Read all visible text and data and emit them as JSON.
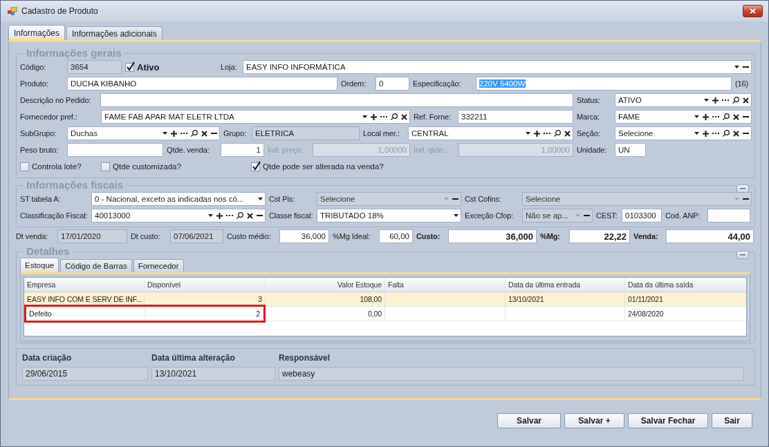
{
  "window": {
    "title": "Cadastro de Produto"
  },
  "tabs": [
    {
      "label": "Informações",
      "selected": true
    },
    {
      "label": "Informações adicionais",
      "selected": false
    }
  ],
  "general": {
    "title": "Informações gerais",
    "lines": [
      {
        "fields": [
          {
            "kind": "label",
            "text": "Código:"
          },
          {
            "kind": "readonly",
            "value": "3654"
          },
          {
            "kind": "check",
            "label": "Ativo",
            "checked": true,
            "bold": true
          },
          {
            "kind": "label",
            "text": "Loja:"
          },
          {
            "kind": "combo",
            "value": "EASY INFO INFORMÁTICA",
            "tools": [
              {
                "kind": "dropdown"
              },
              {
                "kind": "remove"
              }
            ]
          }
        ]
      },
      {
        "fields": [
          {
            "kind": "label",
            "text": "Produto:"
          },
          {
            "kind": "input",
            "value": "DUCHA KIBANHO"
          },
          {
            "kind": "label",
            "text": "Ordem:"
          },
          {
            "kind": "input",
            "value": "0"
          },
          {
            "kind": "label",
            "text": "Especificação:"
          },
          {
            "kind": "input",
            "value": "220V 5400W",
            "text_selected": true
          },
          {
            "kind": "label",
            "text": "(16)"
          }
        ]
      },
      {
        "fields": [
          {
            "kind": "label",
            "text": "Descrição no Pedido:"
          },
          {
            "kind": "input"
          },
          {
            "kind": "label",
            "text": "Status:"
          },
          {
            "kind": "combo",
            "value": "ATIVO",
            "tools": [
              {
                "kind": "dropdown"
              },
              {
                "kind": "add"
              },
              {
                "kind": "more"
              },
              {
                "kind": "search"
              },
              {
                "kind": "clear"
              }
            ]
          }
        ]
      },
      {
        "fields": [
          {
            "kind": "label",
            "text": "Fornecedor pref.:"
          },
          {
            "kind": "combo",
            "value": "FAME FAB APAR MAT ELETR LTDA",
            "tools": [
              {
                "kind": "dropdown"
              },
              {
                "kind": "add"
              },
              {
                "kind": "more"
              },
              {
                "kind": "search"
              },
              {
                "kind": "clear"
              }
            ]
          },
          {
            "kind": "label",
            "text": "Ref. Forne:"
          },
          {
            "kind": "input",
            "value": "332211"
          },
          {
            "kind": "label",
            "text": "Marca:"
          },
          {
            "kind": "combo",
            "value": "FAME",
            "tools": [
              {
                "kind": "dropdown"
              },
              {
                "kind": "add"
              },
              {
                "kind": "more"
              },
              {
                "kind": "search"
              },
              {
                "kind": "clear"
              },
              {
                "kind": "remove"
              }
            ]
          }
        ]
      },
      {
        "fields": [
          {
            "kind": "label",
            "text": "SubGrupo:"
          },
          {
            "kind": "combo",
            "value": "Duchas",
            "tools": [
              {
                "kind": "dropdown"
              },
              {
                "kind": "add"
              },
              {
                "kind": "more"
              },
              {
                "kind": "search"
              },
              {
                "kind": "clear"
              },
              {
                "kind": "remove"
              }
            ]
          },
          {
            "kind": "label",
            "text": "Grupo:"
          },
          {
            "kind": "readonly",
            "value": "ELETRICA"
          },
          {
            "kind": "label",
            "text": "Local mer.:"
          },
          {
            "kind": "combo",
            "value": "CENTRAL",
            "tools": [
              {
                "kind": "dropdown"
              },
              {
                "kind": "add"
              },
              {
                "kind": "more"
              },
              {
                "kind": "search"
              },
              {
                "kind": "clear"
              }
            ]
          },
          {
            "kind": "label",
            "text": "Seção:"
          },
          {
            "kind": "combo",
            "value": "Selecione",
            "tools": [
              {
                "kind": "dropdown"
              },
              {
                "kind": "add"
              },
              {
                "kind": "more"
              },
              {
                "kind": "search"
              },
              {
                "kind": "clear"
              },
              {
                "kind": "remove"
              }
            ]
          }
        ]
      },
      {
        "fields": [
          {
            "kind": "label",
            "text": "Peso bruto:"
          },
          {
            "kind": "input"
          },
          {
            "kind": "label",
            "text": "Qtde. venda:"
          },
          {
            "kind": "input",
            "value": "1",
            "numeric": true
          },
          {
            "kind": "label",
            "text": "Índ. preço:",
            "disabled": true
          },
          {
            "kind": "input",
            "value": "1,00000",
            "numeric": true,
            "disabled": true
          },
          {
            "kind": "label",
            "text": "Índ. qtde.:",
            "disabled": true
          },
          {
            "kind": "input",
            "value": "1,00000",
            "numeric": true,
            "disabled": true
          },
          {
            "kind": "label",
            "text": "Unidade:"
          },
          {
            "kind": "input",
            "value": "UN"
          }
        ]
      },
      {
        "fields": [
          {
            "kind": "check",
            "label": "Controla lote?",
            "checked": false
          },
          {
            "kind": "check",
            "label": "Qtde customizada?",
            "checked": false
          },
          {
            "kind": "check",
            "label": "Qtde pode ser alterada na venda?",
            "checked": true
          }
        ]
      }
    ]
  },
  "fiscal": {
    "title": "Informações fiscais",
    "collapsible": true,
    "lines": [
      {
        "fields": [
          {
            "kind": "label",
            "text": "ST tabela A:"
          },
          {
            "kind": "combo",
            "value": "0 - Nacional, exceto as indicadas nos có...",
            "tools": [
              {
                "kind": "dropdown"
              }
            ]
          },
          {
            "kind": "label",
            "text": "Cst Pis:"
          },
          {
            "kind": "combo",
            "value": "Selecione",
            "tools": [
              {
                "kind": "dropdown"
              },
              {
                "kind": "remove"
              }
            ],
            "disabled": true
          },
          {
            "kind": "label",
            "text": "Cst Cofins:"
          },
          {
            "kind": "combo",
            "value": "Selecione",
            "tools": [
              {
                "kind": "dropdown"
              },
              {
                "kind": "remove"
              }
            ],
            "disabled": true
          }
        ]
      },
      {
        "fields": [
          {
            "kind": "label",
            "text": "Classificação Fiscal:"
          },
          {
            "kind": "combo",
            "value": "40013000",
            "tools": [
              {
                "kind": "dropdown"
              },
              {
                "kind": "add"
              },
              {
                "kind": "more"
              },
              {
                "kind": "search"
              },
              {
                "kind": "clear"
              },
              {
                "kind": "remove"
              }
            ]
          },
          {
            "kind": "label",
            "text": "Classe fiscal:"
          },
          {
            "kind": "combo",
            "value": "TRIBUTADO 18%",
            "tools": [
              {
                "kind": "dropdown"
              }
            ]
          },
          {
            "kind": "label",
            "text": "Exceção Cfop:"
          },
          {
            "kind": "combo",
            "value": "Não se ap...",
            "tools": [
              {
                "kind": "dropdown"
              },
              {
                "kind": "remove"
              }
            ],
            "disabled": true
          },
          {
            "kind": "label",
            "text": "CEST:"
          },
          {
            "kind": "input",
            "value": "0103300"
          },
          {
            "kind": "label",
            "text": "Cod. ANP:"
          },
          {
            "kind": "input"
          }
        ]
      }
    ]
  },
  "prices": [
    {
      "kind": "label",
      "text": "Dt venda:"
    },
    {
      "kind": "readonly",
      "value": "17/01/2020"
    },
    {
      "kind": "label",
      "text": "Dt custo:"
    },
    {
      "kind": "readonly",
      "value": "07/06/2021"
    },
    {
      "kind": "label",
      "text": "Custo médio:"
    },
    {
      "kind": "input",
      "value": "36,000",
      "numeric": true
    },
    {
      "kind": "label",
      "text": "%Mg Ideal:"
    },
    {
      "kind": "input",
      "value": "60,00",
      "numeric": true
    },
    {
      "kind": "label",
      "text": "Custo:",
      "bold": true
    },
    {
      "kind": "input",
      "value": "36,000",
      "numeric": true,
      "bold": true
    },
    {
      "kind": "label",
      "text": "%Mg:",
      "bold": true
    },
    {
      "kind": "input",
      "value": "22,22",
      "numeric": true,
      "bold": true
    },
    {
      "kind": "label",
      "text": "Venda:",
      "bold": true
    },
    {
      "kind": "input",
      "value": "44,00",
      "numeric": true,
      "bold": true
    }
  ],
  "details": {
    "title": "Detalhes",
    "collapsible": true,
    "tabs": [
      {
        "label": "Estoque",
        "selected": true
      },
      {
        "label": "Código de Barras",
        "selected": false
      },
      {
        "label": "Fornecedor",
        "selected": false
      }
    ],
    "table": {
      "columns": [
        {
          "label": "Empresa"
        },
        {
          "label": "Disponível",
          "numeric": true
        },
        {
          "label": "Valor Estoque",
          "numeric": true
        },
        {
          "label": "Falta"
        },
        {
          "label": "Data da última entrada"
        },
        {
          "label": "Data da última saída"
        }
      ],
      "rows": [
        {
          "cells": [
            "EASY INFO COM E SERV DE INF...",
            "3",
            "108,00",
            null,
            "13/10/2021",
            "01/11/2021"
          ],
          "selected": true,
          "marked": false
        },
        {
          "cells": [
            "Defeito",
            "2",
            "0,00",
            null,
            null,
            "24/08/2020"
          ],
          "selected": false,
          "marked": true
        }
      ]
    }
  },
  "audit": [
    {
      "label": "Data criação",
      "value": "29/06/2015"
    },
    {
      "label": "Data última alteração",
      "value": "13/10/2021"
    },
    {
      "label": "Responsável",
      "value": "webeasy"
    }
  ],
  "buttons": [
    "Salvar",
    "Salvar +",
    "Salvar Fechar",
    "Sair"
  ]
}
